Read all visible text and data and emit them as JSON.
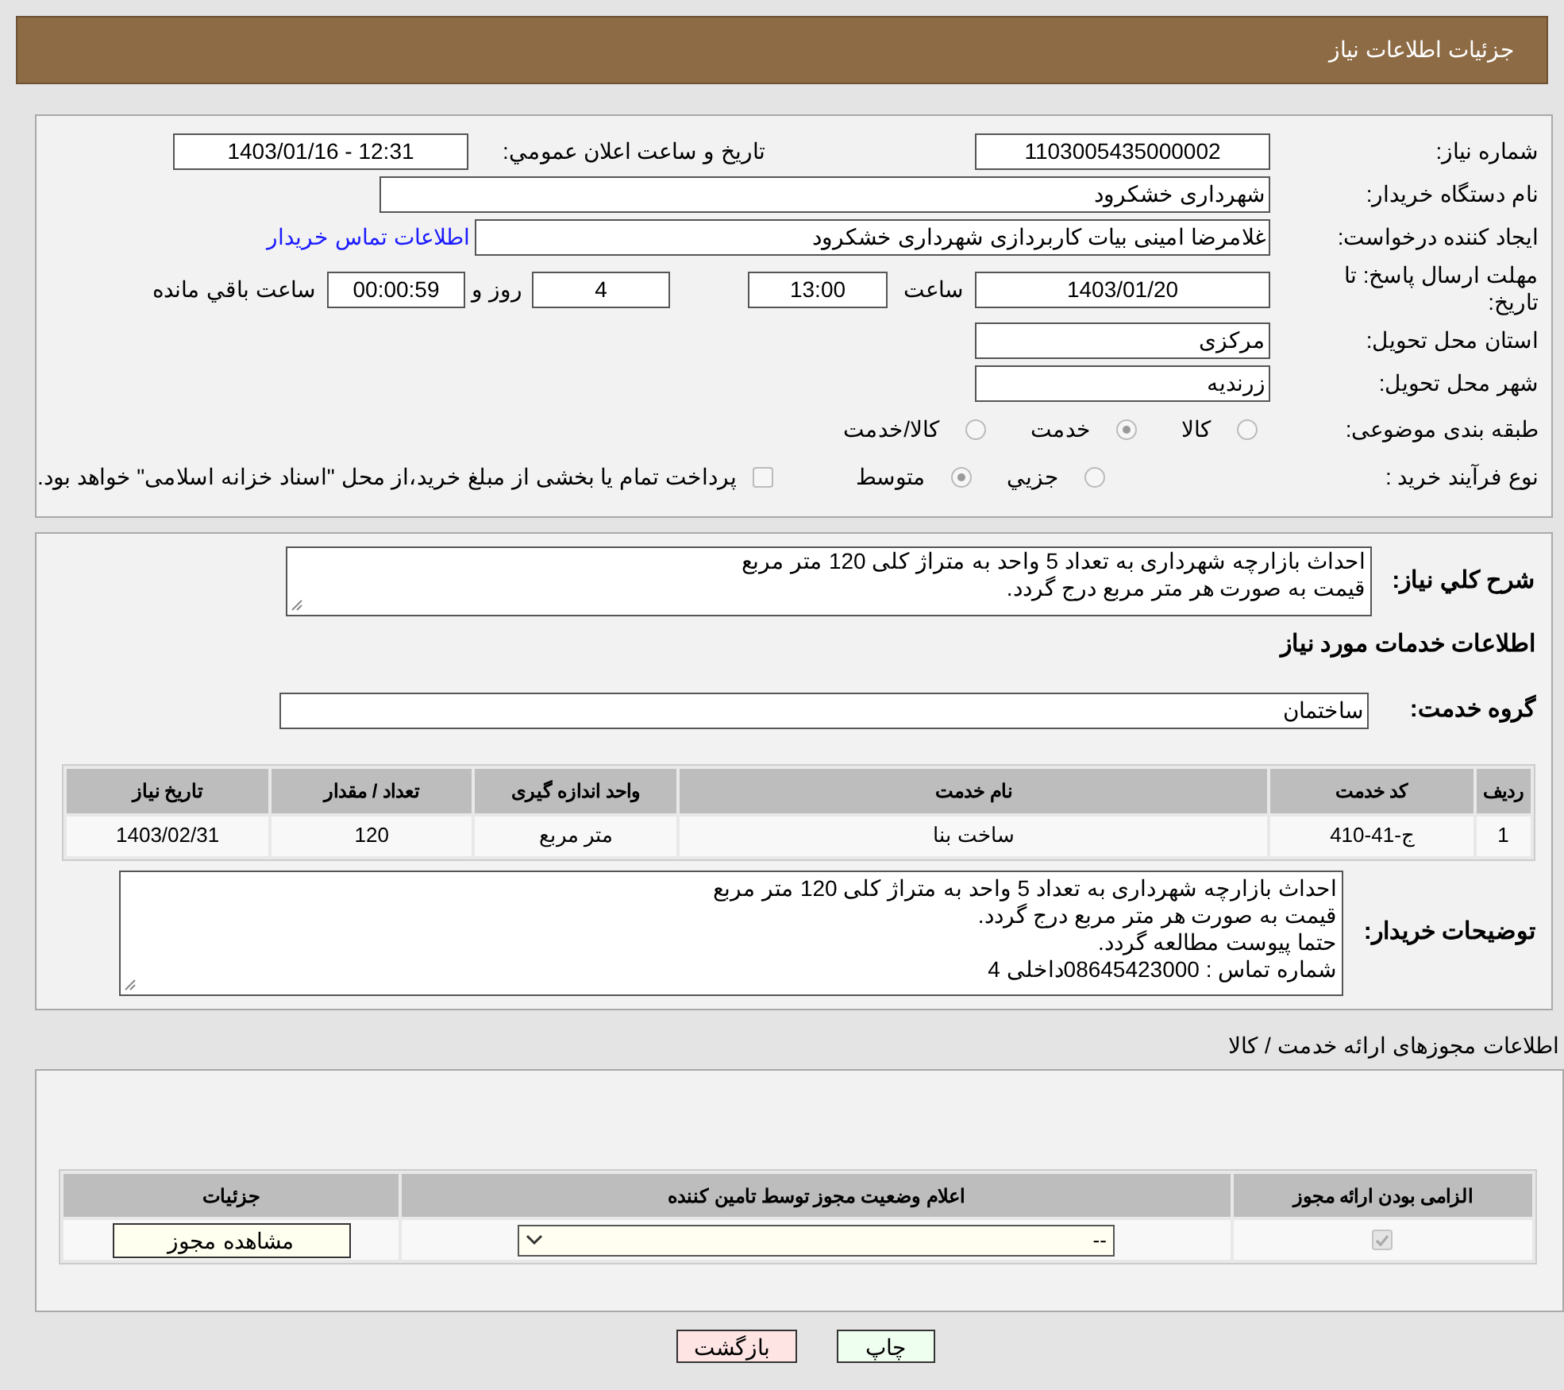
{
  "header": {
    "title": "جزئیات اطلاعات نیاز"
  },
  "details": {
    "need_number": {
      "label": "شماره نیاز:",
      "value": "1103005435000002"
    },
    "announce": {
      "label": "تاریخ و ساعت اعلان عمومي:",
      "value": "1403/01/16 - 12:31"
    },
    "buyer_org": {
      "label": "نام دستگاه خریدار:",
      "value": "شهرداری خشکرود"
    },
    "requester": {
      "label": "ایجاد کننده درخواست:",
      "value": "غلامرضا امینی بیات کاربردازی شهرداری خشکرود",
      "link": "اطلاعات تماس خریدار"
    },
    "deadline": {
      "label": "مهلت ارسال پاسخ: تا تاریخ:",
      "date": "1403/01/20",
      "time_label": "ساعت",
      "time": "13:00",
      "days": "4",
      "days_label": "روز و",
      "remaining": "00:00:59",
      "remaining_label": "ساعت باقي مانده"
    },
    "province": {
      "label": "استان محل تحویل:",
      "value": "مرکزی"
    },
    "city": {
      "label": "شهر محل تحویل:",
      "value": "زرندیه"
    },
    "category": {
      "label": "طبقه بندی موضوعی:",
      "options": [
        {
          "label": "کالا",
          "selected": false
        },
        {
          "label": "خدمت",
          "selected": true
        },
        {
          "label": "کالا/خدمت",
          "selected": false
        }
      ]
    },
    "process": {
      "label": "نوع فرآیند خرید :",
      "options": [
        {
          "label": "جزيي",
          "selected": false
        },
        {
          "label": "متوسط",
          "selected": true
        }
      ],
      "payment": {
        "checked": false,
        "text": "پرداخت تمام یا بخشی از مبلغ خرید،از محل \"اسناد خزانه اسلامی\" خواهد بود."
      }
    }
  },
  "need": {
    "description": {
      "label": "شرح كلي نياز:",
      "lines": [
        "احداث بازارچه شهرداری به تعداد 5 واحد به متراژ کلی 120 متر مربع",
        "قیمت به صورت هر متر مربع درج گردد."
      ]
    },
    "services_heading": "اطلاعات خدمات مورد نیاز",
    "service_group": {
      "label": "گروه خدمت:",
      "value": "ساختمان"
    },
    "table": {
      "columns": [
        "ردیف",
        "کد خدمت",
        "نام خدمت",
        "واحد اندازه گیری",
        "تعداد / مقدار",
        "تاریخ نیاز"
      ],
      "rows": [
        [
          "1",
          "ج-41-410",
          "ساخت بنا",
          "متر مربع",
          "120",
          "1403/02/31"
        ]
      ]
    },
    "buyer_notes": {
      "label": "توضیحات خریدار:",
      "lines": [
        "احداث بازارچه شهرداری به تعداد 5 واحد به متراژ کلی 120 متر مربع",
        "قیمت به صورت هر متر مربع درج گردد.",
        "حتما پیوست مطالعه گردد.",
        "شماره تماس : 08645423000داخلی 4"
      ]
    }
  },
  "licenses": {
    "heading": "اطلاعات مجوزهای ارائه خدمت / کالا",
    "columns": [
      "الزامی بودن ارائه مجوز",
      "اعلام وضعیت مجوز توسط تامین کننده",
      "جزئیات"
    ],
    "rows": [
      {
        "required": true,
        "status": "--",
        "details_button": "مشاهده مجوز"
      }
    ]
  },
  "buttons": [
    {
      "label": "چاپ",
      "kind": "print"
    },
    {
      "label": "بازگشت",
      "kind": "back"
    }
  ]
}
